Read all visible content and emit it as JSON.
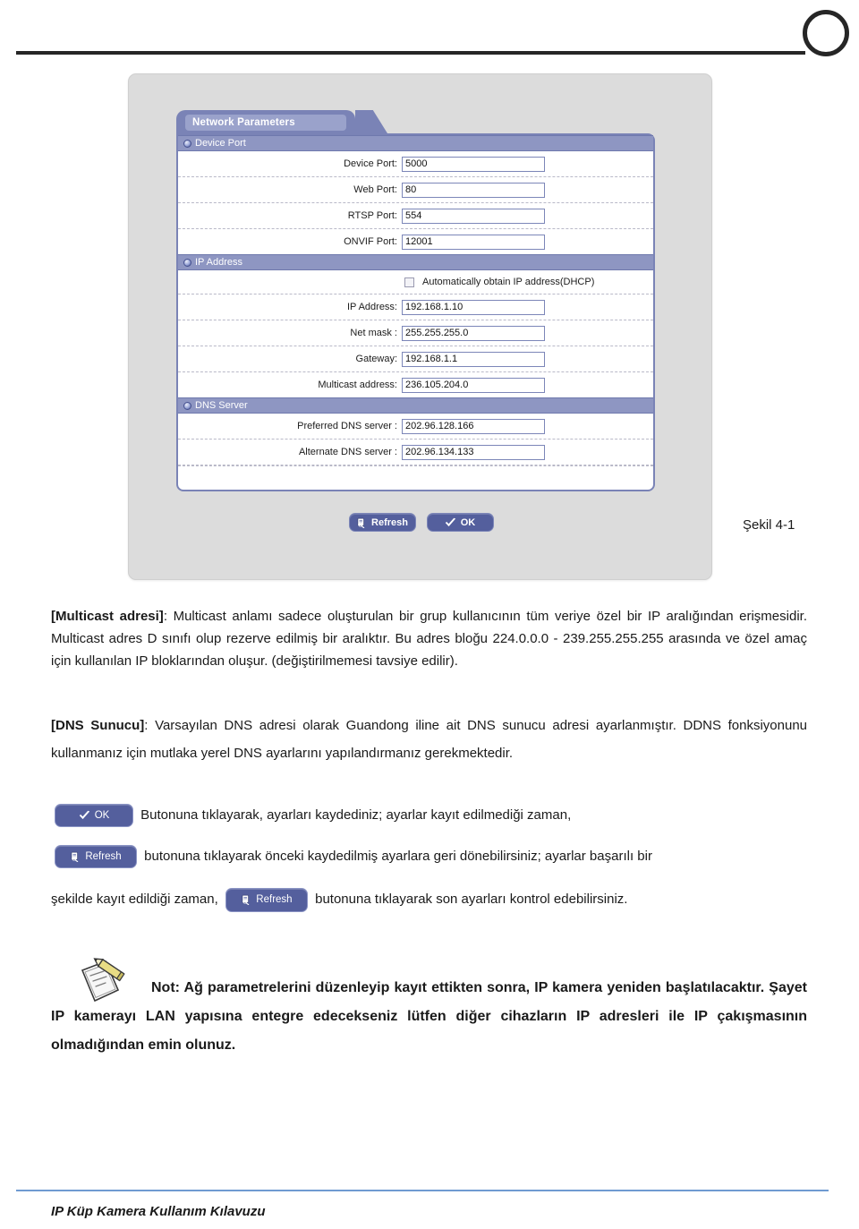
{
  "header": {
    "rule_present": true,
    "logo": "circle-outline"
  },
  "figure": {
    "tab_label": "Network Parameters",
    "caption": "Şekil 4-1",
    "sections": [
      {
        "title": "Device Port",
        "fields": [
          {
            "label": "Device Port:",
            "value": "5000"
          },
          {
            "label": "Web Port:",
            "value": "80"
          },
          {
            "label": "RTSP Port:",
            "value": "554"
          },
          {
            "label": "ONVIF Port:",
            "value": "12001"
          }
        ]
      },
      {
        "title": "IP Address",
        "checkbox": {
          "label": "Automatically obtain IP address(DHCP)",
          "checked": false
        },
        "fields": [
          {
            "label": "IP Address:",
            "value": "192.168.1.10"
          },
          {
            "label": "Net mask :",
            "value": "255.255.255.0"
          },
          {
            "label": "Gateway:",
            "value": "192.168.1.1"
          },
          {
            "label": "Multicast address:",
            "value": "236.105.204.0"
          }
        ]
      },
      {
        "title": "DNS Server",
        "fields": [
          {
            "label": "Preferred DNS server :",
            "value": "202.96.128.166"
          },
          {
            "label": "Alternate DNS server :",
            "value": "202.96.134.133"
          }
        ]
      }
    ],
    "buttons": {
      "refresh": "Refresh",
      "ok": "OK"
    },
    "colors": {
      "panel_bg": "#dcdcdc",
      "section_header": "#8e96c2",
      "tab_bg": "#7a83b6",
      "button_bg": "#545f9d",
      "input_border": "#7c86b8"
    }
  },
  "body": {
    "multicast_heading": "[Multicast adresi]",
    "multicast_text": ": Multicast anlamı sadece oluşturulan bir grup kullanıcının tüm veriye özel bir IP aralığından erişmesidir. Multicast adres D sınıfı olup rezerve edilmiş bir aralıktır. Bu adres bloğu 224.0.0.0 - 239.255.255.255 arasında ve özel amaç için kullanılan IP bloklarından oluşur. (değiştirilmemesi tavsiye edilir).",
    "dns_heading": "[DNS Sunucu]",
    "dns_text": ": Varsayılan DNS adresi olarak Guandong iline ait DNS sunucu adresi ayarlanmıştır. DDNS fonksiyonunu kullanmanız için mutlaka yerel DNS ayarlarını yapılandırmanız gerekmektedir.",
    "ok_button_label": "OK",
    "refresh_button_label": "Refresh",
    "btn_para_1": "Butonuna tıklayarak,  ayarları kaydediniz; ayarlar kayıt edilmediği zaman,",
    "btn_para_2": "butonuna tıklayarak önceki kaydedilmiş ayarlara geri dönebilirsiniz; ayarlar başarılı bir",
    "btn_para_3_pre": "şekilde kayıt edildiği zaman,",
    "btn_para_3_post": "butonuna tıklayarak son ayarları kontrol edebilirsiniz."
  },
  "note": {
    "icon": "note-pencil-icon",
    "text": "Not: Ağ parametrelerini düzenleyip kayıt ettikten sonra, IP kamera yeniden başlatılacaktır. Şayet IP kamerayı LAN yapısına entegre edecekseniz lütfen diğer cihazların IP adresleri ile IP çakışmasının olmadığından emin olunuz."
  },
  "footer": {
    "text": "IP Küp Kamera Kullanım Kılavuzu"
  }
}
